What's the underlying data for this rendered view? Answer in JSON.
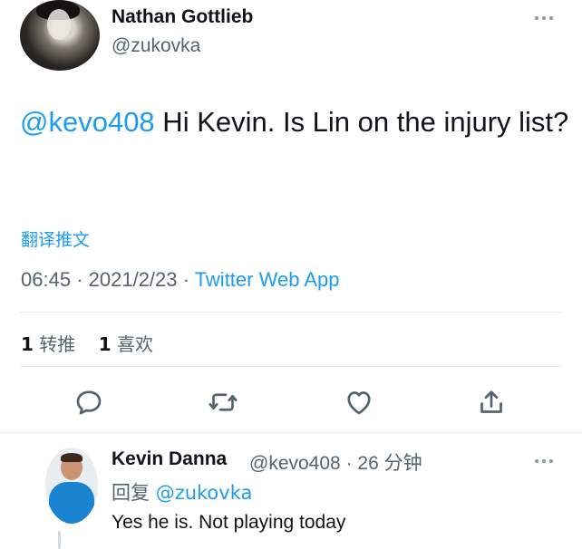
{
  "tweet": {
    "author_name": "Nathan Gottlieb",
    "author_handle": "@zukovka",
    "mention": "@kevo408",
    "text": " Hi Kevin. Is Lin on the injury list?",
    "translate_label": "翻译推文",
    "time": "06:45",
    "date": "2021/2/23",
    "separator": "·",
    "source_app": "Twitter Web App",
    "retweet_count": "1",
    "retweet_label": "转推",
    "like_count": "1",
    "like_label": "喜欢",
    "actions": [
      "reply-icon",
      "retweet-icon",
      "like-icon",
      "share-icon"
    ]
  },
  "reply": {
    "author_name": "Kevin Danna",
    "author_handle": "@kevo408",
    "separator": "·",
    "time_ago": "26 分钟",
    "reply_to_label": "回复",
    "reply_to_handle": "@zukovka",
    "text": "Yes he is. Not playing today"
  },
  "colors": {
    "accent": "#1d9bf0",
    "secondary_text": "#536471",
    "primary_text": "#0f1419"
  }
}
